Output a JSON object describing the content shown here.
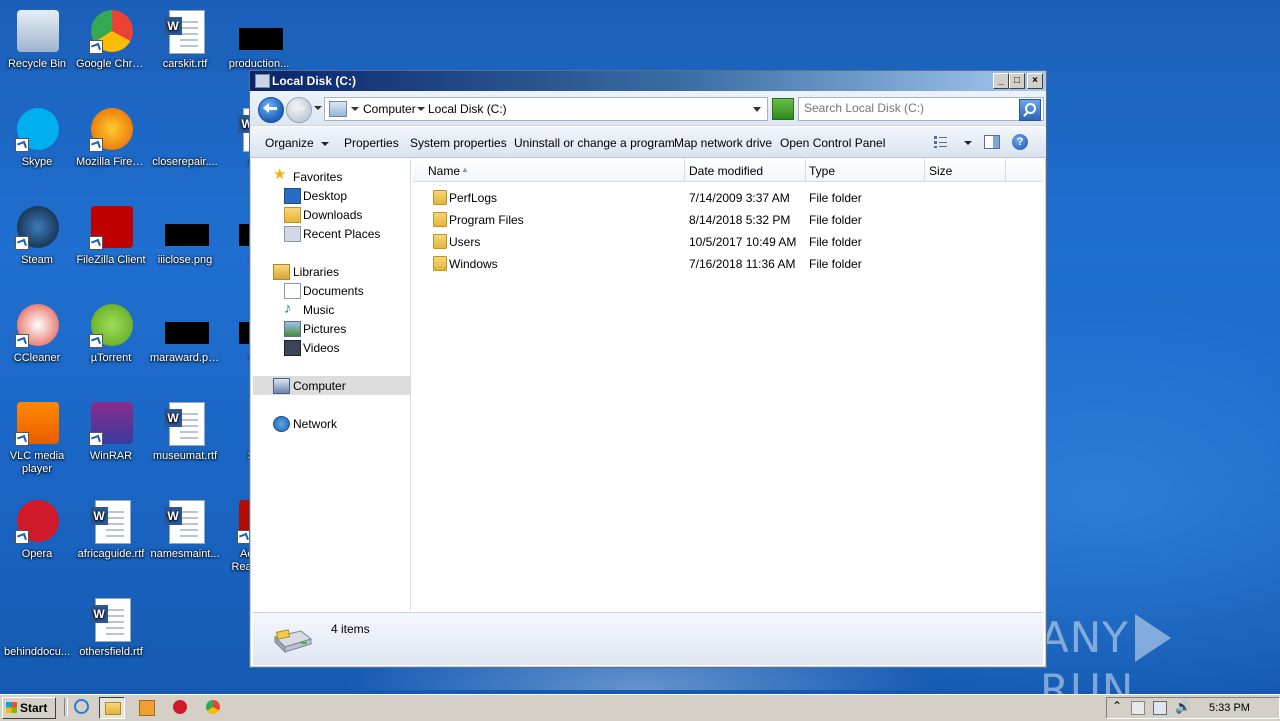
{
  "desktop": {
    "icons": [
      {
        "label": "Recycle Bin",
        "icon": "recycle-bin-icon"
      },
      {
        "label": "Google Chrome",
        "icon": "chrome-icon"
      },
      {
        "label": "carskit.rtf",
        "icon": "word-doc-icon"
      },
      {
        "label": "production...",
        "icon": "image-file-icon"
      },
      {
        "label": "Skype",
        "icon": "skype-icon"
      },
      {
        "label": "Mozilla Firefox",
        "icon": "firefox-icon"
      },
      {
        "label": "closerepair....",
        "icon": "file-icon"
      },
      {
        "label": "stan",
        "icon": "word-doc-icon"
      },
      {
        "label": "Steam",
        "icon": "steam-icon"
      },
      {
        "label": "FileZilla Client",
        "icon": "filezilla-icon"
      },
      {
        "label": "iiiclose.png",
        "icon": "image-file-icon"
      },
      {
        "label": "stre",
        "icon": "image-file-icon"
      },
      {
        "label": "CCleaner",
        "icon": "ccleaner-icon"
      },
      {
        "label": "µTorrent",
        "icon": "utorrent-icon"
      },
      {
        "label": "maraward.png",
        "icon": "image-file-icon"
      },
      {
        "label": "who",
        "icon": "image-file-icon"
      },
      {
        "label": "VLC media player",
        "icon": "vlc-icon"
      },
      {
        "label": "WinRAR",
        "icon": "winrar-icon"
      },
      {
        "label": "museumat.rtf",
        "icon": "word-doc-icon"
      },
      {
        "label": "Setu",
        "icon": "file-icon"
      },
      {
        "label": "Opera",
        "icon": "opera-icon"
      },
      {
        "label": "africaguide.rtf",
        "icon": "word-doc-icon"
      },
      {
        "label": "namesmaint...",
        "icon": "word-doc-icon"
      },
      {
        "label": "Acrobat Reader DC",
        "icon": "acrobat-icon"
      },
      {
        "label": "behinddocu...",
        "icon": "file-icon"
      },
      {
        "label": "othersfield.rtf",
        "icon": "word-doc-icon"
      }
    ]
  },
  "watermark": {
    "left": "ANY",
    "right": "RUN"
  },
  "window": {
    "title": "Local Disk (C:)",
    "controls": {
      "minimize": "_",
      "maximize": "□",
      "close": "×"
    },
    "address": {
      "crumbs": [
        "Computer",
        "Local Disk (C:)"
      ]
    },
    "search": {
      "placeholder": "Search Local Disk (C:)"
    },
    "toolbar": {
      "organize": "Organize",
      "properties": "Properties",
      "system_properties": "System properties",
      "uninstall": "Uninstall or change a program",
      "map_drive": "Map network drive",
      "control_panel": "Open Control Panel",
      "help": "?"
    },
    "nav": {
      "favorites": "Favorites",
      "desktop": "Desktop",
      "downloads": "Downloads",
      "recent": "Recent Places",
      "libraries": "Libraries",
      "documents": "Documents",
      "music": "Music",
      "pictures": "Pictures",
      "videos": "Videos",
      "computer": "Computer",
      "network": "Network"
    },
    "columns": {
      "name": "Name",
      "date": "Date modified",
      "type": "Type",
      "size": "Size"
    },
    "files": [
      {
        "name": "PerfLogs",
        "date": "7/14/2009 3:37 AM",
        "type": "File folder",
        "size": ""
      },
      {
        "name": "Program Files",
        "date": "8/14/2018 5:32 PM",
        "type": "File folder",
        "size": ""
      },
      {
        "name": "Users",
        "date": "10/5/2017 10:49 AM",
        "type": "File folder",
        "size": ""
      },
      {
        "name": "Windows",
        "date": "7/16/2018 11:36 AM",
        "type": "File folder",
        "size": ""
      }
    ],
    "status": {
      "count": "4 items"
    }
  },
  "taskbar": {
    "start": "Start",
    "clock": "5:33 PM"
  },
  "colors": {
    "accent": "#1b5fb8",
    "titlebar": "#0a246a",
    "taskbar": "#d4d0c8"
  }
}
